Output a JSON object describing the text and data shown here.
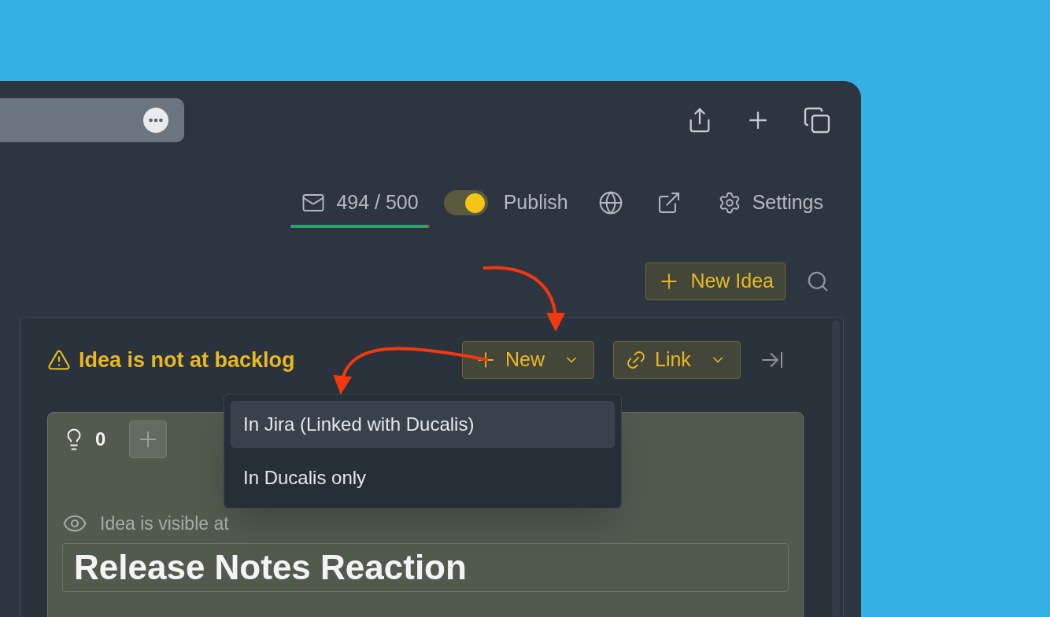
{
  "header": {
    "counter": {
      "label": "494 / 500",
      "level": 0.988
    },
    "publish": {
      "label": "Publish",
      "on": true
    },
    "settings": {
      "label": "Settings"
    }
  },
  "new_idea_button": {
    "label": "New Idea"
  },
  "panel": {
    "warning": "Idea is not at backlog",
    "actions": [
      {
        "kind": "new",
        "label": "New"
      },
      {
        "kind": "link",
        "label": "Link"
      }
    ],
    "dropdown": [
      {
        "label": "In Jira (Linked with Ducalis)",
        "selected": true
      },
      {
        "label": "In Ducalis only",
        "selected": false
      }
    ],
    "card": {
      "votes": "0",
      "visibility": "Idea is visible at",
      "title": "Release Notes Reaction"
    }
  }
}
